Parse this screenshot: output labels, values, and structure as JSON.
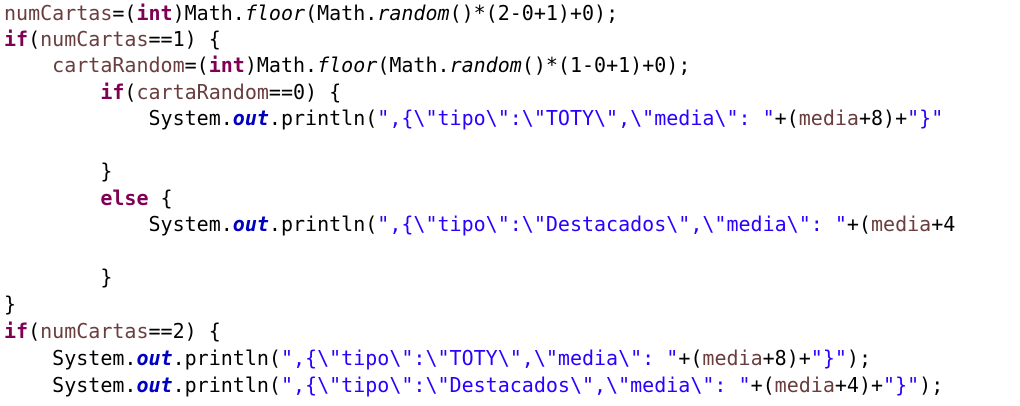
{
  "editor": {
    "colors": {
      "background": "#ffffff",
      "local_variable": "#6a3e3e",
      "keyword": "#7f0055",
      "string": "#2a00ff",
      "static_field": "#0000c0",
      "plain": "#000000"
    },
    "lines": [
      [
        {
          "t": "numCartas",
          "k": "var"
        },
        {
          "t": "=(",
          "k": "pl"
        },
        {
          "t": "int",
          "k": "kw"
        },
        {
          "t": ")Math.",
          "k": "pl"
        },
        {
          "t": "floor",
          "k": "it"
        },
        {
          "t": "(Math.",
          "k": "pl"
        },
        {
          "t": "random",
          "k": "it"
        },
        {
          "t": "()*(2-0+1)+0);",
          "k": "pl"
        }
      ],
      [
        {
          "t": "if",
          "k": "kw"
        },
        {
          "t": "(",
          "k": "pl"
        },
        {
          "t": "numCartas",
          "k": "var"
        },
        {
          "t": "==1) {",
          "k": "pl"
        }
      ],
      [
        {
          "t": "    ",
          "k": "pl"
        },
        {
          "t": "cartaRandom",
          "k": "var"
        },
        {
          "t": "=(",
          "k": "pl"
        },
        {
          "t": "int",
          "k": "kw"
        },
        {
          "t": ")Math.",
          "k": "pl"
        },
        {
          "t": "floor",
          "k": "it"
        },
        {
          "t": "(Math.",
          "k": "pl"
        },
        {
          "t": "random",
          "k": "it"
        },
        {
          "t": "()*(1-0+1)+0);",
          "k": "pl"
        }
      ],
      [
        {
          "t": "        ",
          "k": "pl"
        },
        {
          "t": "if",
          "k": "kw"
        },
        {
          "t": "(",
          "k": "pl"
        },
        {
          "t": "cartaRandom",
          "k": "var"
        },
        {
          "t": "==0) {",
          "k": "pl"
        }
      ],
      [
        {
          "t": "            System.",
          "k": "pl"
        },
        {
          "t": "out",
          "k": "fld"
        },
        {
          "t": ".println(",
          "k": "pl"
        },
        {
          "t": "\",{\\\"tipo\\\":\\\"TOTY\\\",\\\"media\\\": \"",
          "k": "str"
        },
        {
          "t": "+(",
          "k": "pl"
        },
        {
          "t": "media",
          "k": "var"
        },
        {
          "t": "+8)+",
          "k": "pl"
        },
        {
          "t": "\"}\"",
          "k": "str"
        }
      ],
      [],
      [
        {
          "t": "        }",
          "k": "pl"
        }
      ],
      [
        {
          "t": "        ",
          "k": "pl"
        },
        {
          "t": "else",
          "k": "kw"
        },
        {
          "t": " {",
          "k": "pl"
        }
      ],
      [
        {
          "t": "            System.",
          "k": "pl"
        },
        {
          "t": "out",
          "k": "fld"
        },
        {
          "t": ".println(",
          "k": "pl"
        },
        {
          "t": "\",{\\\"tipo\\\":\\\"Destacados\\\",\\\"media\\\": \"",
          "k": "str"
        },
        {
          "t": "+(",
          "k": "pl"
        },
        {
          "t": "media",
          "k": "var"
        },
        {
          "t": "+4",
          "k": "pl"
        }
      ],
      [],
      [
        {
          "t": "        }",
          "k": "pl"
        }
      ],
      [
        {
          "t": "}",
          "k": "pl"
        }
      ],
      [
        {
          "t": "if",
          "k": "kw"
        },
        {
          "t": "(",
          "k": "pl"
        },
        {
          "t": "numCartas",
          "k": "var"
        },
        {
          "t": "==2) {",
          "k": "pl"
        }
      ],
      [
        {
          "t": "    System.",
          "k": "pl"
        },
        {
          "t": "out",
          "k": "fld"
        },
        {
          "t": ".println(",
          "k": "pl"
        },
        {
          "t": "\",{\\\"tipo\\\":\\\"TOTY\\\",\\\"media\\\": \"",
          "k": "str"
        },
        {
          "t": "+(",
          "k": "pl"
        },
        {
          "t": "media",
          "k": "var"
        },
        {
          "t": "+8)+",
          "k": "pl"
        },
        {
          "t": "\"}\"",
          "k": "str"
        },
        {
          "t": ");",
          "k": "pl"
        }
      ],
      [
        {
          "t": "    System.",
          "k": "pl"
        },
        {
          "t": "out",
          "k": "fld"
        },
        {
          "t": ".println(",
          "k": "pl"
        },
        {
          "t": "\",{\\\"tipo\\\":\\\"Destacados\\\",\\\"media\\\": \"",
          "k": "str"
        },
        {
          "t": "+(",
          "k": "pl"
        },
        {
          "t": "media",
          "k": "var"
        },
        {
          "t": "+4)+",
          "k": "pl"
        },
        {
          "t": "\"}\"",
          "k": "str"
        },
        {
          "t": ");",
          "k": "pl"
        }
      ]
    ]
  }
}
